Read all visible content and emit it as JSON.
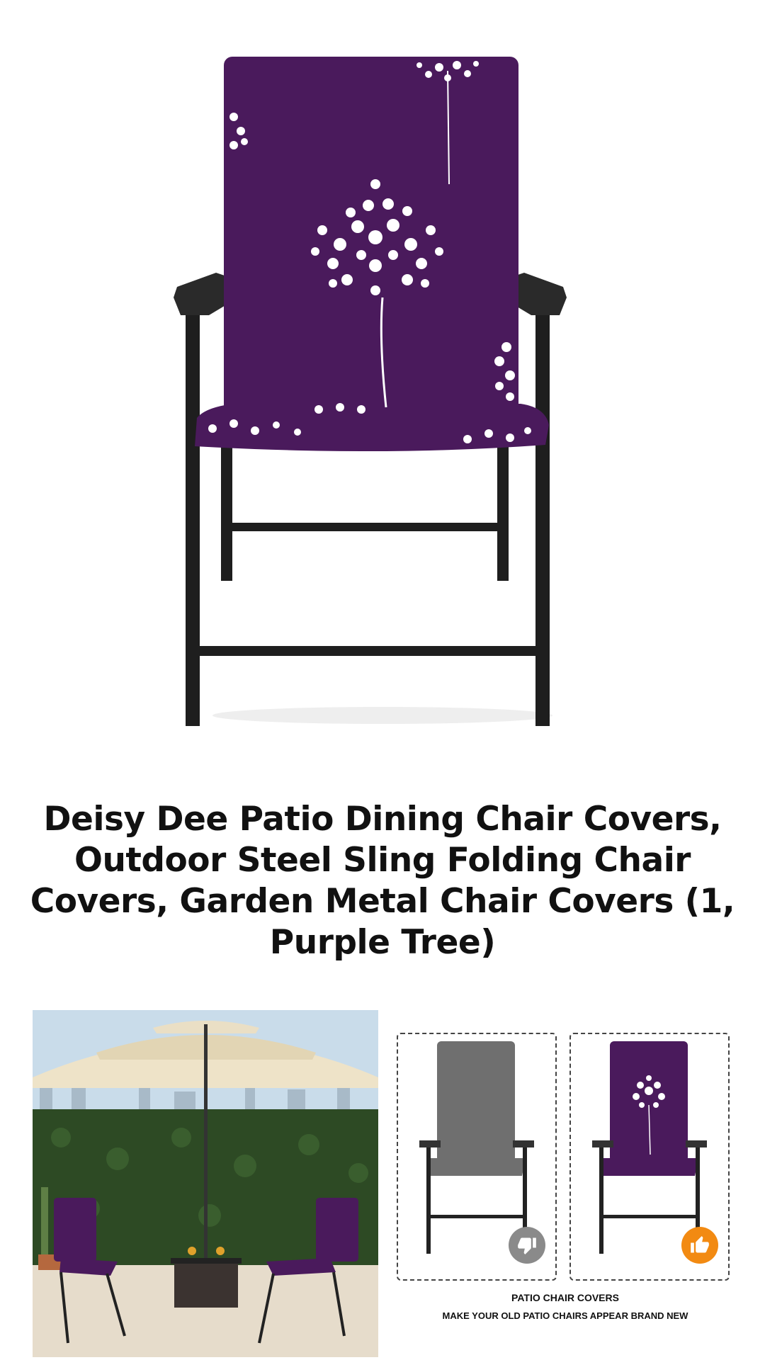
{
  "product": {
    "title": "Deisy Dee Patio Dining Chair Covers, Outdoor Steel Sling Folding Chair Covers, Garden Metal Chair Covers (1, Purple Tree)"
  },
  "comparison": {
    "caption_line1": "PATIO CHAIR COVERS",
    "caption_line2": "MAKE YOUR OLD PATIO CHAIRS APPEAR BRAND NEW",
    "before_icon": "thumbs-down-icon",
    "after_icon": "thumbs-up-icon"
  },
  "colors": {
    "cover_purple": "#4a1a5c",
    "frame_black": "#1e1e1e",
    "badge_gray": "#8a8a8a",
    "badge_orange": "#f28a12"
  }
}
